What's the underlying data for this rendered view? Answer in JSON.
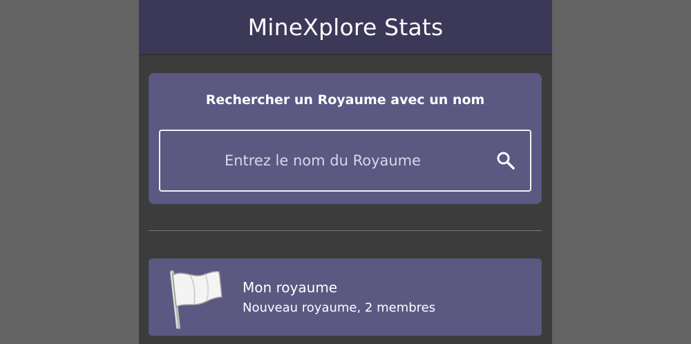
{
  "app": {
    "title": "MineXplore Stats"
  },
  "search": {
    "heading": "Rechercher un Royaume avec un nom",
    "placeholder": "Entrez le nom du Royaume",
    "value": "",
    "icon": "search-icon"
  },
  "kingdoms": [
    {
      "name": "Mon royaume",
      "subtitle": "Nouveau royaume, 2 membres",
      "icon": "white-flag-icon"
    }
  ],
  "colors": {
    "header_bg": "#3c3858",
    "card_bg": "#5b5882",
    "page_bg": "#3c3c3c",
    "outer_bg": "#646464"
  }
}
